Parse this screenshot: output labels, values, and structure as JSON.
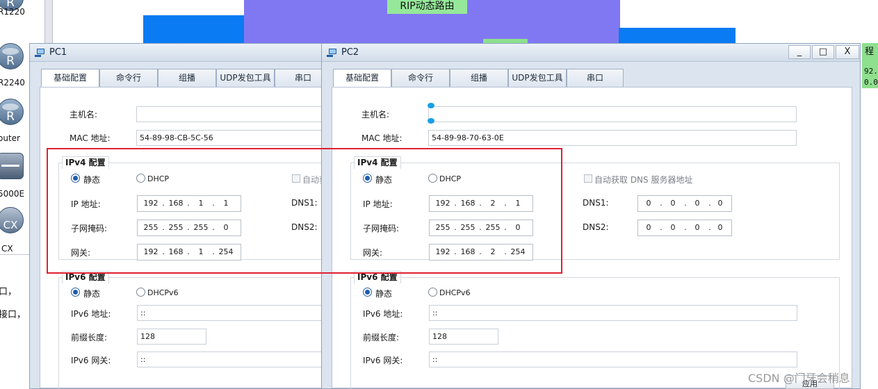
{
  "palette": {
    "devices": [
      {
        "label": "R1220",
        "icon": "router-icon",
        "glyph": "R"
      },
      {
        "label": "R2240",
        "icon": "router-icon",
        "glyph": "R"
      },
      {
        "label": "outer",
        "icon": "router-icon",
        "glyph": "R"
      },
      {
        "label": "5000E",
        "icon": "switch-icon",
        "glyph": ""
      },
      {
        "label": "CX",
        "icon": "cx-device-icon",
        "glyph": "CX"
      }
    ],
    "notes": [
      "口，",
      "接口，"
    ]
  },
  "topology": {
    "area_label": "RIP动态路由",
    "side_note": {
      "line1": "程",
      "line2": "92.",
      "line3": "0.0"
    },
    "colors": {
      "area_blue": "#0a7bf2",
      "area_purple": "#8078f2",
      "label_green": "#95e89a"
    }
  },
  "pc1": {
    "title": "PC1",
    "tabs": [
      "基础配置",
      "命令行",
      "组播",
      "UDP发包工具",
      "串口"
    ],
    "active_tab": "基础配置",
    "hostname_label": "主机名:",
    "hostname": "",
    "mac_label": "MAC 地址:",
    "mac": "54-89-98-CB-5C-56",
    "ipv4": {
      "title": "IPv4 配置",
      "static_label": "静态",
      "dhcp_label": "DHCP",
      "auto_dns_label": "自动获",
      "ip_label": "IP 地址:",
      "ip": [
        "192",
        "168",
        "1",
        "1"
      ],
      "mask_label": "子网掩码:",
      "mask": [
        "255",
        "255",
        "255",
        "0"
      ],
      "gw_label": "网关:",
      "gw": [
        "192",
        "168",
        "1",
        "254"
      ],
      "dns1_label": "DNS1:",
      "dns2_label": "DNS2:"
    },
    "ipv6": {
      "title": "IPv6 配置",
      "static_label": "静态",
      "dhcp_label": "DHCPv6",
      "ip_label": "IPv6 地址:",
      "ip": "::",
      "prefix_label": "前缀长度:",
      "prefix": "128",
      "gw_label": "IPv6 网关:",
      "gw": "::"
    }
  },
  "pc2": {
    "title": "PC2",
    "controls": {
      "minimize": "_",
      "maximize": "□",
      "close": "X"
    },
    "tabs": [
      "基础配置",
      "命令行",
      "组播",
      "UDP发包工具",
      "串口"
    ],
    "active_tab": "基础配置",
    "hostname_label": "主机名:",
    "hostname": "",
    "mac_label": "MAC 地址:",
    "mac": "54-89-98-70-63-0E",
    "ipv4": {
      "title": "IPv4 配置",
      "static_label": "静态",
      "dhcp_label": "DHCP",
      "auto_dns_label": "自动获取 DNS 服务器地址",
      "ip_label": "IP 地址:",
      "ip": [
        "192",
        "168",
        "2",
        "1"
      ],
      "mask_label": "子网掩码:",
      "mask": [
        "255",
        "255",
        "255",
        "0"
      ],
      "gw_label": "网关:",
      "gw": [
        "192",
        "168",
        "2",
        "254"
      ],
      "dns1_label": "DNS1:",
      "dns1": [
        "0",
        "0",
        "0",
        "0"
      ],
      "dns2_label": "DNS2:",
      "dns2": [
        "0",
        "0",
        "0",
        "0"
      ]
    },
    "ipv6": {
      "title": "IPv6 配置",
      "static_label": "静态",
      "dhcp_label": "DHCPv6",
      "ip_label": "IPv6 地址:",
      "ip": "::",
      "prefix_label": "前缀长度:",
      "prefix": "128",
      "gw_label": "IPv6 网关:",
      "gw": "::"
    },
    "apply_label": "应用"
  },
  "watermark": "CSDN @门牙会稍息",
  "highlight_color": "#e02030"
}
